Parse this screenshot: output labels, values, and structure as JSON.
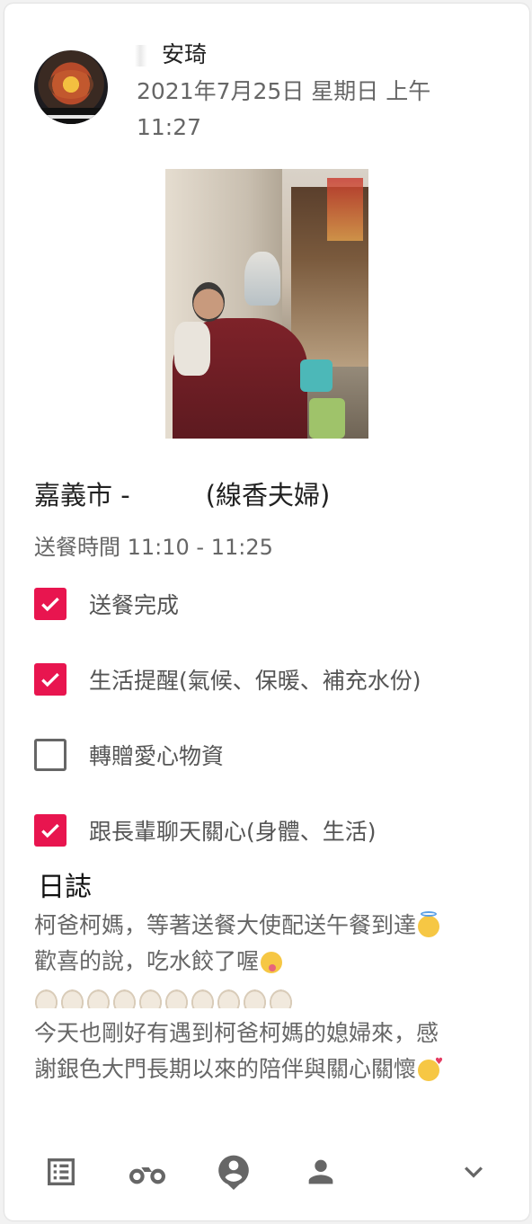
{
  "post": {
    "author_name": "安琦",
    "date": "2021年7月25日 星期日 上午",
    "time": "11:27"
  },
  "client": {
    "city": "嘉義市 -",
    "note": "(線香夫婦)"
  },
  "delivery_time": "送餐時間 11:10 - 11:25",
  "checklist": [
    {
      "label": "送餐完成",
      "checked": true
    },
    {
      "label": "生活提醒(氣候、保暖、補充水份)",
      "checked": true
    },
    {
      "label": "轉贈愛心物資",
      "checked": false
    },
    {
      "label": "跟長輩聊天關心(身體、生活)",
      "checked": true
    }
  ],
  "log": {
    "title": "日誌",
    "line1": "柯爸柯媽，等著送餐大使配送午餐到達",
    "line2": "歡喜的說，吃水餃了喔",
    "line4": "今天也剛好有遇到柯爸柯媽的媳婦來，感",
    "line5": "謝銀色大門長期以來的陪伴與關心關懷"
  },
  "icons": {
    "checked": "checkbox-checked-icon",
    "unchecked": "checkbox-unchecked-icon",
    "nav": [
      "list-icon",
      "motorcycle-icon",
      "account-pin-icon",
      "person-icon",
      "chevron-down-icon"
    ]
  },
  "colors": {
    "accent": "#e8154f",
    "text_secondary": "#666666"
  }
}
